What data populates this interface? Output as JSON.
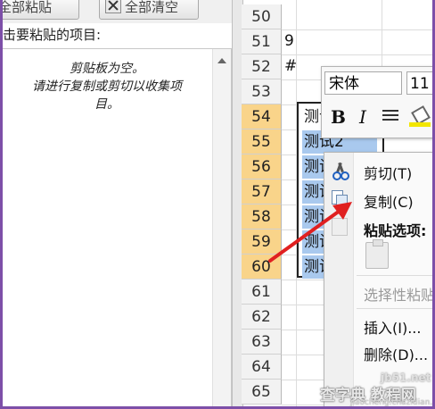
{
  "clipboard": {
    "paste_all_label": "全部粘贴",
    "clear_all_label": "全部清空",
    "prompt": "击要粘贴的项目:",
    "empty_line1": "剪贴板为空。",
    "empty_line2": "请进行复制或剪切以收集项",
    "empty_line3": "目。"
  },
  "sheet": {
    "rows": [
      "50",
      "51",
      "52",
      "53",
      "54",
      "55",
      "56",
      "57",
      "58",
      "59",
      "60",
      "61",
      "62",
      "63",
      "64",
      "65"
    ],
    "selected_rows": [
      "54",
      "55",
      "56",
      "57",
      "58",
      "59",
      "60"
    ],
    "cell_51": "9",
    "cell_52": "#",
    "selected_cells": [
      "测试",
      "测试2",
      "测试",
      "测试",
      "测试",
      "测试",
      "测试"
    ]
  },
  "mini_toolbar": {
    "font_name": "宋体",
    "font_size": "11",
    "bold": "B",
    "italic": "I"
  },
  "context_menu": {
    "cut": "剪切(T)",
    "copy": "复制(C)",
    "paste_options": "粘贴选项:",
    "paste_special": "选择性粘贴",
    "insert": "插入(I)...",
    "delete": "删除(D)..."
  },
  "watermark": {
    "site": "jb51.net",
    "name": "查字典 教程网",
    "url": "jiaocheng.chazidian.com"
  },
  "colors": {
    "selected_row_header": "#f9d48a",
    "selection_fill": "#a9c9ee",
    "arrow": "#e02020",
    "frame": "#7d4fa8"
  }
}
